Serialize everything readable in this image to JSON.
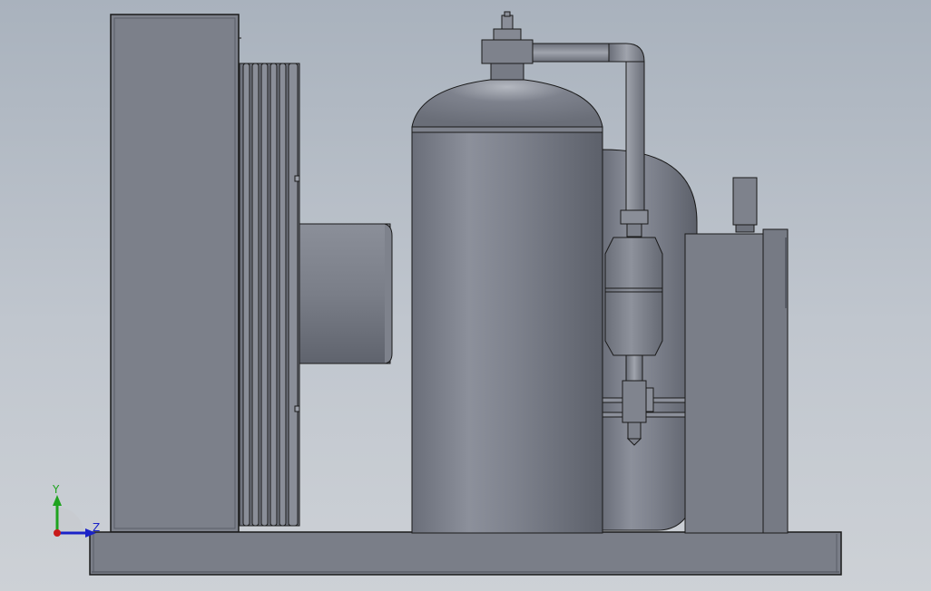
{
  "scene": {
    "description_visible": false,
    "background_top": "#a9b2bd",
    "background_bottom": "#cdd1d6",
    "body_color": "#7a7e88",
    "edge_color": "#1a1a1a"
  },
  "triad": {
    "x_label": "Y",
    "z_label": "Z",
    "y_color": "#1fa31f",
    "z_color": "#1a22c8",
    "origin_color": "#c81a1a"
  }
}
